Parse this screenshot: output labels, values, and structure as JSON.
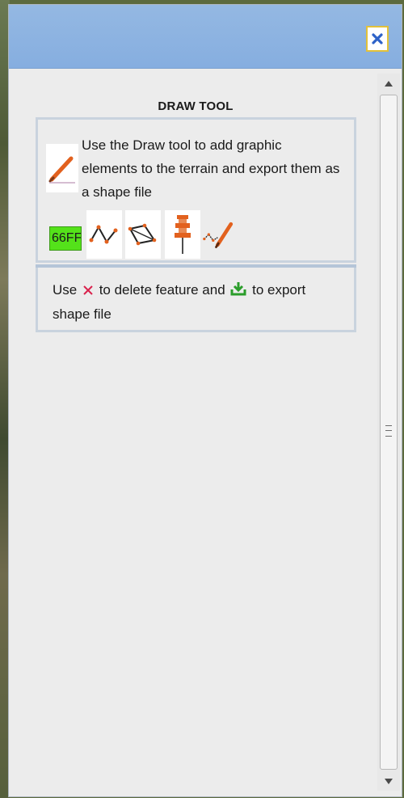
{
  "header": {
    "close_label": "×"
  },
  "panel": {
    "title": "DRAW TOOL",
    "description": "Use the Draw tool to add graphic elements to the terrain and export them as a shape file",
    "swatch_label": "66FF",
    "note": {
      "part1": "Use ",
      "part2": " to delete feature and ",
      "part3": " to export shape file"
    }
  },
  "tools": [
    {
      "name": "line-tool",
      "icon": "polyline-icon"
    },
    {
      "name": "polygon-tool",
      "icon": "polygon-icon"
    },
    {
      "name": "point-tool",
      "icon": "pushpin-icon"
    },
    {
      "name": "freehand-tool",
      "icon": "pencil-line-icon"
    }
  ],
  "colors": {
    "header": "#86aee0",
    "accent_orange": "#e2611e",
    "swatch": "#54e21a",
    "delete": "#d9224c",
    "export": "#2a9d2a"
  }
}
